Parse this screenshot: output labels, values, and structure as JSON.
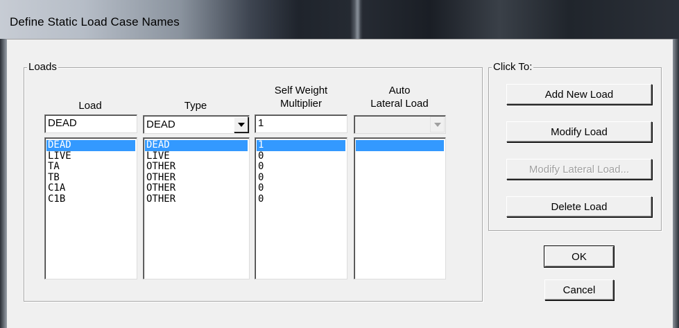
{
  "window": {
    "title": "Define Static Load Case Names"
  },
  "loads_group": {
    "label": "Loads",
    "headers": {
      "load": "Load",
      "type": "Type",
      "self_weight_line1": "Self Weight",
      "self_weight_line2": "Multiplier",
      "auto_line1": "Auto",
      "auto_line2": "Lateral Load"
    },
    "inputs": {
      "load_value": "DEAD",
      "type_value": "DEAD",
      "multiplier_value": "1",
      "auto_lateral_value": ""
    },
    "rows": [
      {
        "load": "DEAD",
        "type": "DEAD",
        "multiplier": "1",
        "auto": ""
      },
      {
        "load": "LIVE",
        "type": "LIVE",
        "multiplier": "0",
        "auto": ""
      },
      {
        "load": "TA",
        "type": "OTHER",
        "multiplier": "0",
        "auto": ""
      },
      {
        "load": "TB",
        "type": "OTHER",
        "multiplier": "0",
        "auto": ""
      },
      {
        "load": "C1A",
        "type": "OTHER",
        "multiplier": "0",
        "auto": ""
      },
      {
        "load": "C1B",
        "type": "OTHER",
        "multiplier": "0",
        "auto": ""
      }
    ],
    "selected_index": 0
  },
  "click_to_group": {
    "label": "Click To:",
    "add_new_load": "Add New Load",
    "modify_load": "Modify Load",
    "modify_lateral_load": "Modify Lateral Load...",
    "delete_load": "Delete Load"
  },
  "ok_label": "OK",
  "cancel_label": "Cancel",
  "colors": {
    "selection": "#3399ff",
    "dialog_bg": "#f0f0f0"
  },
  "icons": {
    "dropdown": "chevron-down-icon"
  }
}
